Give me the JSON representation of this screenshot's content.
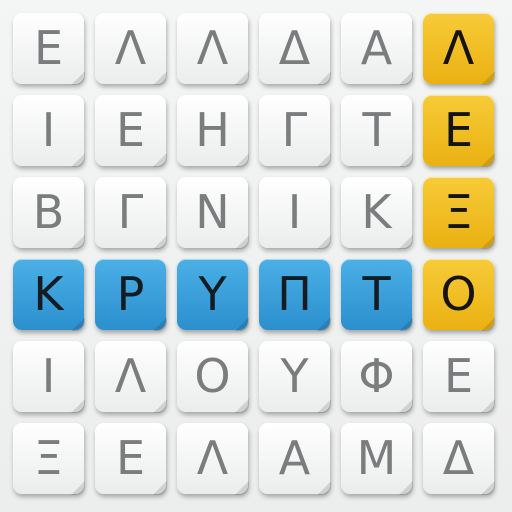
{
  "grid": {
    "rows": [
      [
        "Ε",
        "Λ",
        "Λ",
        "Δ",
        "Α",
        "Λ"
      ],
      [
        "Ι",
        "Ε",
        "Η",
        "Γ",
        "Τ",
        "Ε"
      ],
      [
        "Β",
        "Γ",
        "Ν",
        "Ι",
        "Κ",
        "Ξ"
      ],
      [
        "Κ",
        "Ρ",
        "Υ",
        "Π",
        "Τ",
        "Ο"
      ],
      [
        "Ι",
        "Λ",
        "Ο",
        "Υ",
        "Φ",
        "Ε"
      ],
      [
        "Ξ",
        "Ε",
        "Λ",
        "Α",
        "Μ",
        "Δ"
      ]
    ],
    "highlights": {
      "horizontal_word": {
        "row": 3,
        "from_col": 0,
        "to_col": 4,
        "color": "blue"
      },
      "vertical_word": {
        "col": 5,
        "from_row": 0,
        "to_row": 3,
        "color": "yellow"
      }
    }
  },
  "colors": {
    "background": "#f1f2f2",
    "tile_plain": "#ffffff",
    "tile_text_plain": "#7a7c7e",
    "highlight_blue": "#3a9fda",
    "highlight_yellow": "#f2be25",
    "highlight_text": "#151b22"
  }
}
